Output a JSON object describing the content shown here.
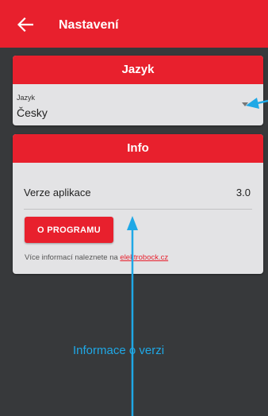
{
  "appbar": {
    "title": "Nastavení",
    "back_icon": "arrow-left-icon"
  },
  "language_card": {
    "header": "Jazyk",
    "field_label": "Jazyk",
    "field_value": "Česky"
  },
  "info_card": {
    "header": "Info",
    "version_label": "Verze aplikace",
    "version_value": "3.0",
    "about_button": "O PROGRAMU",
    "more_info_prefix": "Více informací naleznete na ",
    "more_info_link": "elektrobock.cz"
  },
  "annotation": {
    "text": "Informace o verzi"
  },
  "colors": {
    "accent": "#e8202d",
    "annotation": "#1fa8e6",
    "background": "#37393b",
    "card": "#e3e3e5"
  }
}
